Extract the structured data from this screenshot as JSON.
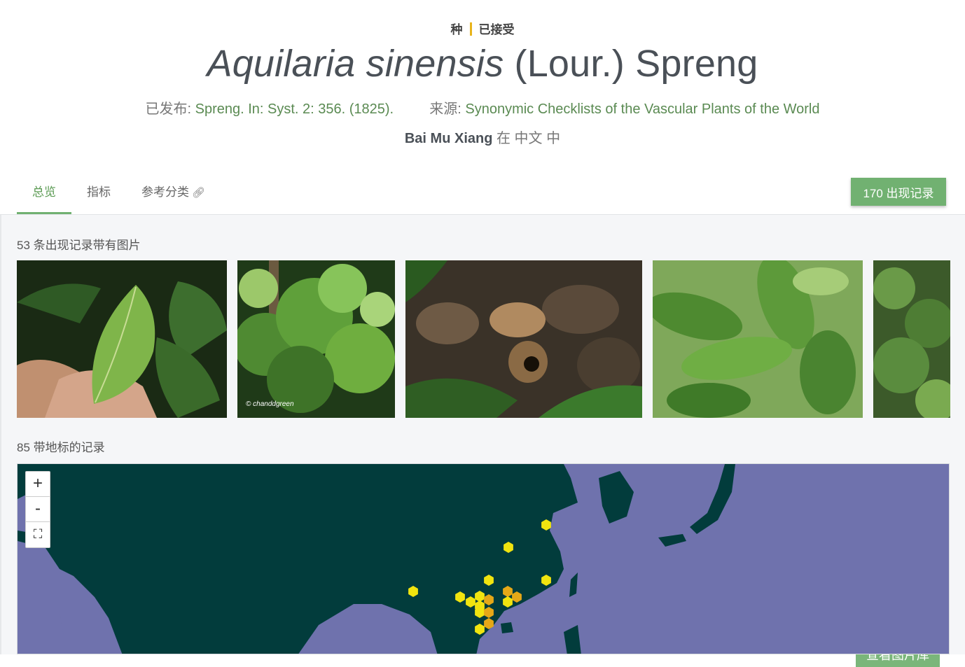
{
  "taxon": {
    "rank": "种",
    "status": "已接受",
    "scientific_name": "Aquilaria sinensis",
    "authorship": "(Lour.) Spreng",
    "published_label": "已发布:",
    "published_value": "Spreng. In: Syst. 2: 356. (1825).",
    "source_label": "来源:",
    "source_value": "Synonymic Checklists of the Vascular Plants of the World",
    "vernacular_name": "Bai Mu Xiang",
    "vernacular_suffix": "在 中文 中"
  },
  "tabs": [
    {
      "label": "总览",
      "active": true
    },
    {
      "label": "指标",
      "active": false
    },
    {
      "label": "参考分类",
      "active": false,
      "icon": "link-icon"
    }
  ],
  "occurrence_button": "170 出现记录",
  "images_section": {
    "label": "53 条出现记录带有图片",
    "gallery_button": "查看图片库",
    "watermark": "© chanddgreen"
  },
  "map_section": {
    "label": "85 带地标的记录",
    "zoom_in": "+",
    "zoom_out": "-",
    "fullscreen_icon": "fullscreen-icon"
  },
  "colors": {
    "accent": "#71b171",
    "rank_separator": "#e8b41b",
    "map_sea": "#6f72ad",
    "map_land": "#023c3c",
    "marker_yellow": "#f1e40f",
    "marker_orange": "#e6a817"
  }
}
